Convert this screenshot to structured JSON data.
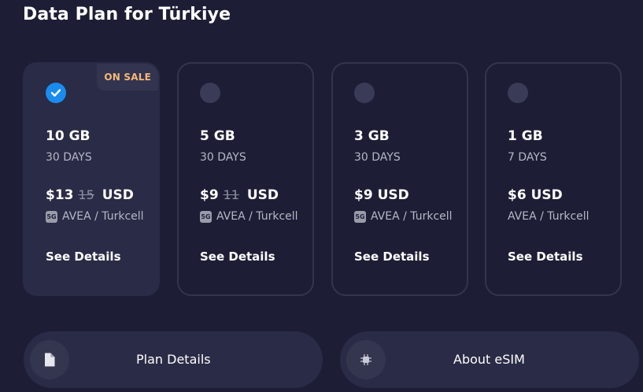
{
  "page": {
    "title": "Data Plan for Türkiye"
  },
  "plans": [
    {
      "selected": true,
      "badge": "ON SALE",
      "data": "10 GB",
      "duration": "30 DAYS",
      "price": "$13",
      "old_price": "15",
      "currency": "USD",
      "network_badge": "5G",
      "carrier": "AVEA / Turkcell",
      "details_label": "See Details"
    },
    {
      "selected": false,
      "data": "5 GB",
      "duration": "30 DAYS",
      "price": "$9",
      "old_price": "11",
      "currency": "USD",
      "network_badge": "5G",
      "carrier": "AVEA / Turkcell",
      "details_label": "See Details"
    },
    {
      "selected": false,
      "data": "3 GB",
      "duration": "30 DAYS",
      "price": "$9",
      "currency": "USD",
      "network_badge": "5G",
      "carrier": "AVEA / Turkcell",
      "details_label": "See Details"
    },
    {
      "selected": false,
      "data": "1 GB",
      "duration": "7 DAYS",
      "price": "$6",
      "currency": "USD",
      "carrier": "AVEA / Turkcell",
      "details_label": "See Details"
    }
  ],
  "footer": {
    "plan_details_label": "Plan Details",
    "plan_details_icon": "document-icon",
    "about_esim_label": "About eSIM",
    "about_esim_icon": "chip-icon"
  },
  "colors": {
    "background": "#1d1e36",
    "card_selected": "#2a2b46",
    "accent": "#1a8cf0",
    "sale": "#f5b97a"
  }
}
